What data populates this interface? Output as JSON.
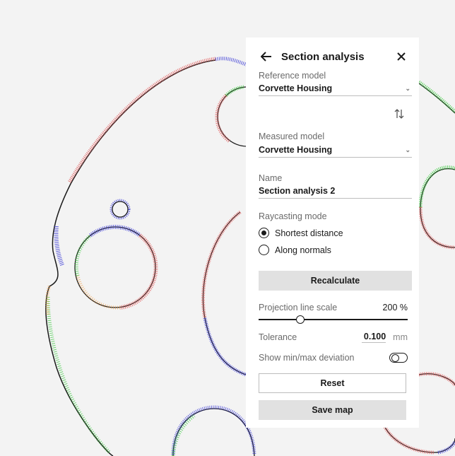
{
  "panel": {
    "title": "Section analysis",
    "reference_label": "Reference model",
    "reference_value": "Corvette Housing",
    "measured_label": "Measured model",
    "measured_value": "Corvette Housing",
    "name_label": "Name",
    "name_value": "Section analysis 2",
    "raycasting_label": "Raycasting mode",
    "raycasting_options": [
      "Shortest distance",
      "Along normals"
    ],
    "raycasting_selected": "Shortest distance",
    "recalculate_label": "Recalculate",
    "projection_label": "Projection line scale",
    "projection_value": "200 %",
    "projection_fraction": 0.28,
    "tolerance_label": "Tolerance",
    "tolerance_value": "0.100",
    "tolerance_unit": "mm",
    "minmax_label": "Show min/max deviation",
    "minmax_enabled": false,
    "reset_label": "Reset",
    "save_label": "Save map"
  },
  "icons": {
    "back": "arrow-left-icon",
    "close": "close-icon",
    "swap": "swap-vertical-icon",
    "chevron": "chevron-down-icon"
  },
  "colors": {
    "deviation_red": "#e05a5a",
    "deviation_blue": "#3b3bd6",
    "deviation_green": "#39c93d",
    "deviation_orange": "#f0a04a",
    "outline": "#1a1a1a"
  }
}
